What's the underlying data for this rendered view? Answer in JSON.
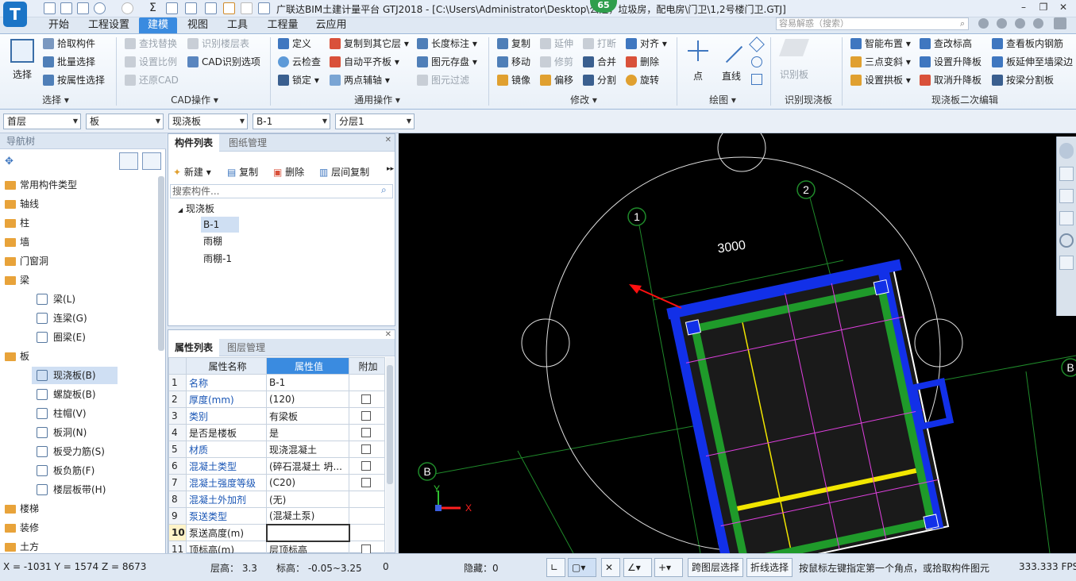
{
  "titlebar": {
    "title": "广联达BIM土建计量平台 GTJ2018 - [C:\\Users\\Administrator\\Desktop\\公建，垃圾房，配电房\\门卫\\1,2号楼门卫.GTJ]",
    "logo_letter": "T",
    "online_count": "65",
    "search_placeholder": "容易解惑（搜索）"
  },
  "tabs": [
    "开始",
    "工程设置",
    "建模",
    "视图",
    "工具",
    "工程量",
    "云应用"
  ],
  "active_tab": "建模",
  "ribbon": {
    "select_group": {
      "big": "选择",
      "items": [
        "拾取构件",
        "批量选择",
        "按属性选择"
      ],
      "label": "选择"
    },
    "cad_group": {
      "items": [
        "查找替换",
        "设置比例",
        "还原CAD",
        "识别楼层表",
        "CAD识别选项"
      ],
      "label": "CAD操作"
    },
    "common_group": {
      "items": [
        "定义",
        "云检查",
        "锁定",
        "复制到其它层",
        "自动平齐板",
        "两点辅轴",
        "长度标注",
        "图元存盘",
        "图元过滤"
      ],
      "label": "通用操作"
    },
    "modify_group": {
      "items": [
        "复制",
        "移动",
        "镜像",
        "延伸",
        "修剪",
        "偏移",
        "打断",
        "合并",
        "分割",
        "对齐",
        "删除",
        "旋转"
      ],
      "label": "修改"
    },
    "draw_group": {
      "items": [
        "点",
        "直线"
      ],
      "label": "绘图"
    },
    "recognize_group": {
      "items": [
        "识别板"
      ],
      "label": "识别现浇板"
    },
    "slab_group": {
      "items": [
        "智能布置",
        "三点变斜",
        "设置拱板",
        "查改标高",
        "设置升降板",
        "取消升降板",
        "查看板内钢筋",
        "板延伸至墙梁边",
        "按梁分割板"
      ],
      "label": "现浇板二次编辑"
    }
  },
  "selectors": [
    "首层",
    "板",
    "现浇板",
    "B-1",
    "分层1"
  ],
  "nav": {
    "title": "导航树",
    "items": [
      {
        "label": "常用构件类型",
        "type": "folder"
      },
      {
        "label": "轴线",
        "type": "folder"
      },
      {
        "label": "柱",
        "type": "folder"
      },
      {
        "label": "墙",
        "type": "folder"
      },
      {
        "label": "门窗洞",
        "type": "folder"
      },
      {
        "label": "梁",
        "type": "folder"
      },
      {
        "label": "梁(L)",
        "type": "sub"
      },
      {
        "label": "连梁(G)",
        "type": "sub"
      },
      {
        "label": "圈梁(E)",
        "type": "sub"
      },
      {
        "label": "板",
        "type": "folder"
      },
      {
        "label": "现浇板(B)",
        "type": "sub",
        "selected": true
      },
      {
        "label": "螺旋板(B)",
        "type": "sub"
      },
      {
        "label": "柱帽(V)",
        "type": "sub"
      },
      {
        "label": "板洞(N)",
        "type": "sub"
      },
      {
        "label": "板受力筋(S)",
        "type": "sub"
      },
      {
        "label": "板负筋(F)",
        "type": "sub"
      },
      {
        "label": "楼层板带(H)",
        "type": "sub"
      },
      {
        "label": "楼梯",
        "type": "folder"
      },
      {
        "label": "装修",
        "type": "folder"
      },
      {
        "label": "土方",
        "type": "folder"
      }
    ]
  },
  "component_panel": {
    "tabs": [
      "构件列表",
      "图纸管理"
    ],
    "toolbar": [
      "新建",
      "复制",
      "删除",
      "层间复制"
    ],
    "search_placeholder": "搜索构件...",
    "root": "现浇板",
    "items": [
      "B-1",
      "雨棚",
      "雨棚-1"
    ]
  },
  "property_panel": {
    "tabs": [
      "属性列表",
      "图层管理"
    ],
    "headers": [
      "属性名称",
      "属性值",
      "附加"
    ],
    "rows": [
      {
        "no": "1",
        "name": "名称",
        "value": "B-1",
        "check": false,
        "blue": true
      },
      {
        "no": "2",
        "name": "厚度(mm)",
        "value": "(120)",
        "check": true,
        "blue": true
      },
      {
        "no": "3",
        "name": "类别",
        "value": "有梁板",
        "check": true,
        "blue": true
      },
      {
        "no": "4",
        "name": "是否是楼板",
        "value": "是",
        "check": true,
        "blue": false
      },
      {
        "no": "5",
        "name": "材质",
        "value": "现浇混凝土",
        "check": true,
        "blue": true
      },
      {
        "no": "6",
        "name": "混凝土类型",
        "value": "(碎石混凝土 坍...",
        "check": true,
        "blue": true
      },
      {
        "no": "7",
        "name": "混凝土强度等级",
        "value": "(C20)",
        "check": true,
        "blue": true
      },
      {
        "no": "8",
        "name": "混凝土外加剂",
        "value": "(无)",
        "check": false,
        "blue": true
      },
      {
        "no": "9",
        "name": "泵送类型",
        "value": "(混凝土泵)",
        "check": false,
        "blue": true
      },
      {
        "no": "10",
        "name": "泵送高度(m)",
        "value": "",
        "check": false,
        "blue": false
      },
      {
        "no": "11",
        "name": "顶标高(m)",
        "value": "层顶标高",
        "check": true,
        "blue": false
      }
    ]
  },
  "canvas": {
    "dimension_text": "3000",
    "axis_labels": [
      "1",
      "2",
      "B",
      "B"
    ],
    "x_axis": "X",
    "y_axis": "Y"
  },
  "status": {
    "coords": "X = -1031 Y = 1574 Z = 8673",
    "floor_height": "层高： 3.3",
    "elevation": "标高： -0.05~3.25",
    "zero": "0",
    "hidden": "隐藏：0",
    "btn_cross_layer": "跨图层选择",
    "btn_polyline": "折线选择",
    "hint": "按鼠标左键指定第一个角点，或拾取构件图元",
    "fps": "333.333 FPS"
  }
}
